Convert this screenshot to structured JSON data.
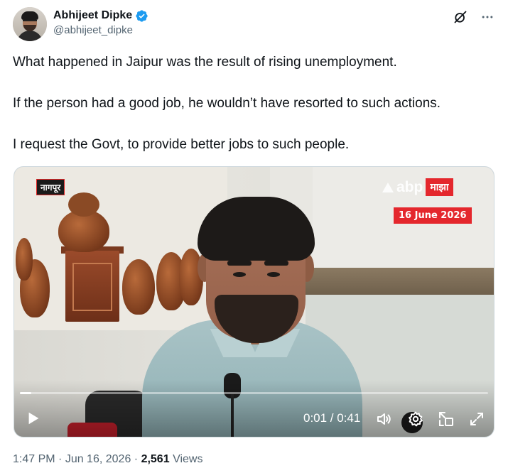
{
  "author": {
    "display_name": "Abhijeet Dipke",
    "handle": "@abhijeet_dipke",
    "verified": true,
    "verified_color": "#1d9bf0"
  },
  "icons": {
    "grok": "grok-icon",
    "more": "more-icon"
  },
  "tweet": {
    "paragraphs": [
      "What happened in Jaipur was the result of rising unemployment.",
      "If the person had a good job, he wouldn’t have resorted to such actions.",
      "I request the Govt, to provide better jobs to such people."
    ]
  },
  "video": {
    "overlay_location": "नागपूर",
    "channel_logo_text": "abp",
    "channel_badge": "माझा",
    "date_overlay": "16 June 2026",
    "time_display": "0:01 / 0:41",
    "progress": 0.024,
    "accent": "#e4272d"
  },
  "footer": {
    "time": "1:47 PM",
    "separator": " · ",
    "date": "Jun 16, 2026",
    "views_count": "2,561",
    "views_label": "Views"
  }
}
